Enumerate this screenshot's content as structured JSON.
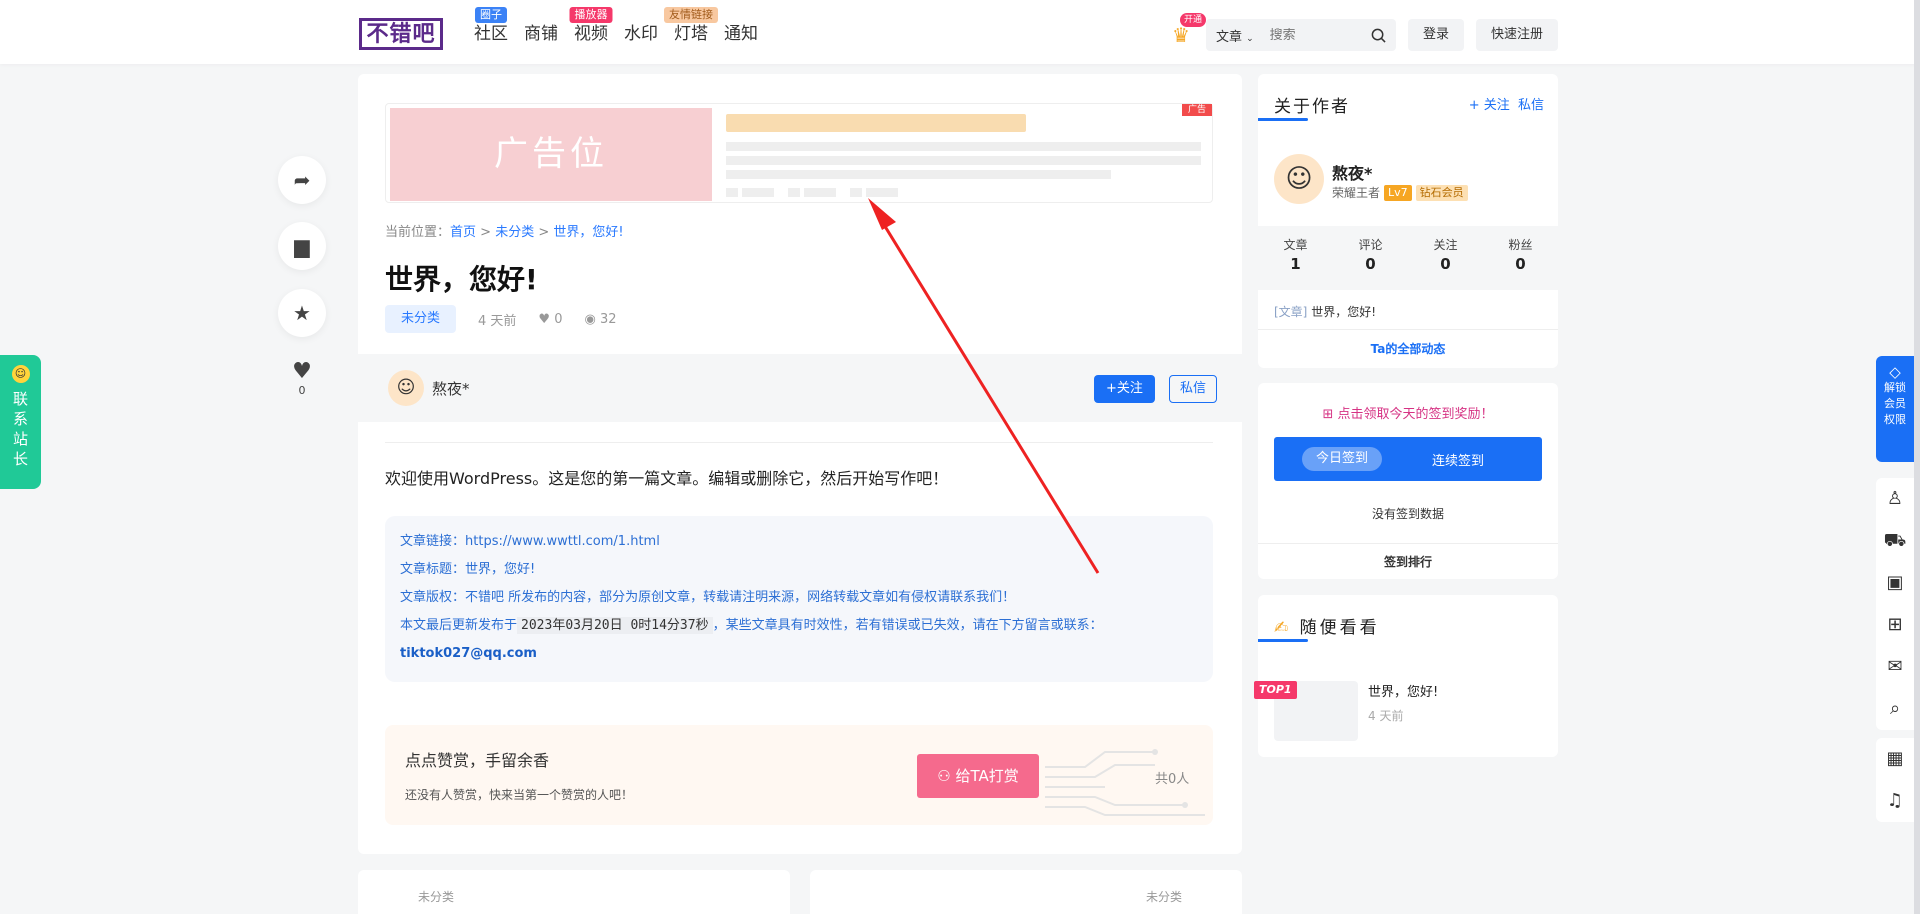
{
  "header": {
    "logo": "不错吧",
    "nav": [
      {
        "label": "社区",
        "badge": "圈子",
        "badge_color": "#3b82f6"
      },
      {
        "label": "商铺",
        "badge": "",
        "badge_color": ""
      },
      {
        "label": "视频",
        "badge": "播放器",
        "badge_color": "#f5386a"
      },
      {
        "label": "水印",
        "badge": "",
        "badge_color": ""
      },
      {
        "label": "灯塔",
        "badge": "友情链接",
        "badge_color": "#f8c8a0"
      },
      {
        "label": "通知",
        "badge": "",
        "badge_color": ""
      }
    ],
    "vip_badge": "开通",
    "search_category": "文章",
    "search_placeholder": "搜索",
    "login": "登录",
    "register": "快速注册"
  },
  "left_float": {
    "like_count": "0",
    "contact_label": "联系站长"
  },
  "article": {
    "ad_label": "广告位",
    "ad_tag": "广告",
    "breadcrumb_prefix": "当前位置：",
    "breadcrumb": [
      "首页",
      "未分类",
      "世界，您好!"
    ],
    "title": "世界，您好!",
    "category": "未分类",
    "time": "4 天前",
    "likes": "0",
    "views": "32",
    "author_name": "熬夜*",
    "follow_btn": "+关注",
    "message_btn": "私信",
    "content": "欢迎使用WordPress。这是您的第一篇文章。编辑或删除它，然后开始写作吧！",
    "info": {
      "link_label": "文章链接：",
      "link": "https://www.wwttl.com/1.html",
      "title_label": "文章标题：",
      "title": "世界，您好!",
      "copyright": "文章版权：不错吧 所发布的内容，部分为原创文章，转载请注明来源，网络转载文章如有侵权请联系我们！",
      "update_prefix": "本文最后更新发布于",
      "update_time": "2023年03月20日 0时14分37秒",
      "update_suffix": "，某些文章具有时效性，若有错误或已失效，请在下方留言或联系：",
      "contact_email": "tiktok027@qq.com"
    },
    "reward_title": "点点赞赏，手留余香",
    "reward_sub": "还没有人赞赏，快来当第一个赞赏的人吧！",
    "reward_btn": "给TA打赏",
    "reward_total": "共0人"
  },
  "related": [
    {
      "category": "未分类"
    },
    {
      "category": "未分类"
    }
  ],
  "sidebar": {
    "about_title": "关于作者",
    "about_follow": "+ 关注",
    "about_message": "私信",
    "author_name": "熬夜*",
    "author_rank": "荣耀王者",
    "author_level": "Lv7",
    "author_vip": "钻石会员",
    "stats": [
      {
        "label": "文章",
        "value": "1"
      },
      {
        "label": "评论",
        "value": "0"
      },
      {
        "label": "关注",
        "value": "0"
      },
      {
        "label": "粉丝",
        "value": "0"
      }
    ],
    "recent_tag": "[文章]",
    "recent_title": "世界，您好!",
    "all_activity": "Ta的全部动态",
    "checkin_hint": "点击领取今天的签到奖励！",
    "checkin_today": "今日签到",
    "checkin_continuous": "连续签到",
    "checkin_none": "没有签到数据",
    "checkin_rank": "签到排行",
    "random_title": "随便看看",
    "random_item_title": "世界，您好!",
    "random_item_time": "4 天前",
    "random_item_badge": "TOP1"
  },
  "right_toolbar": {
    "unlock_label": "解锁会员权限",
    "icons": [
      "user-icon",
      "cart-icon",
      "ticket-icon",
      "gift-icon",
      "mail-icon",
      "search-icon"
    ],
    "icons2": [
      "qrcode-icon",
      "bell-icon"
    ]
  }
}
